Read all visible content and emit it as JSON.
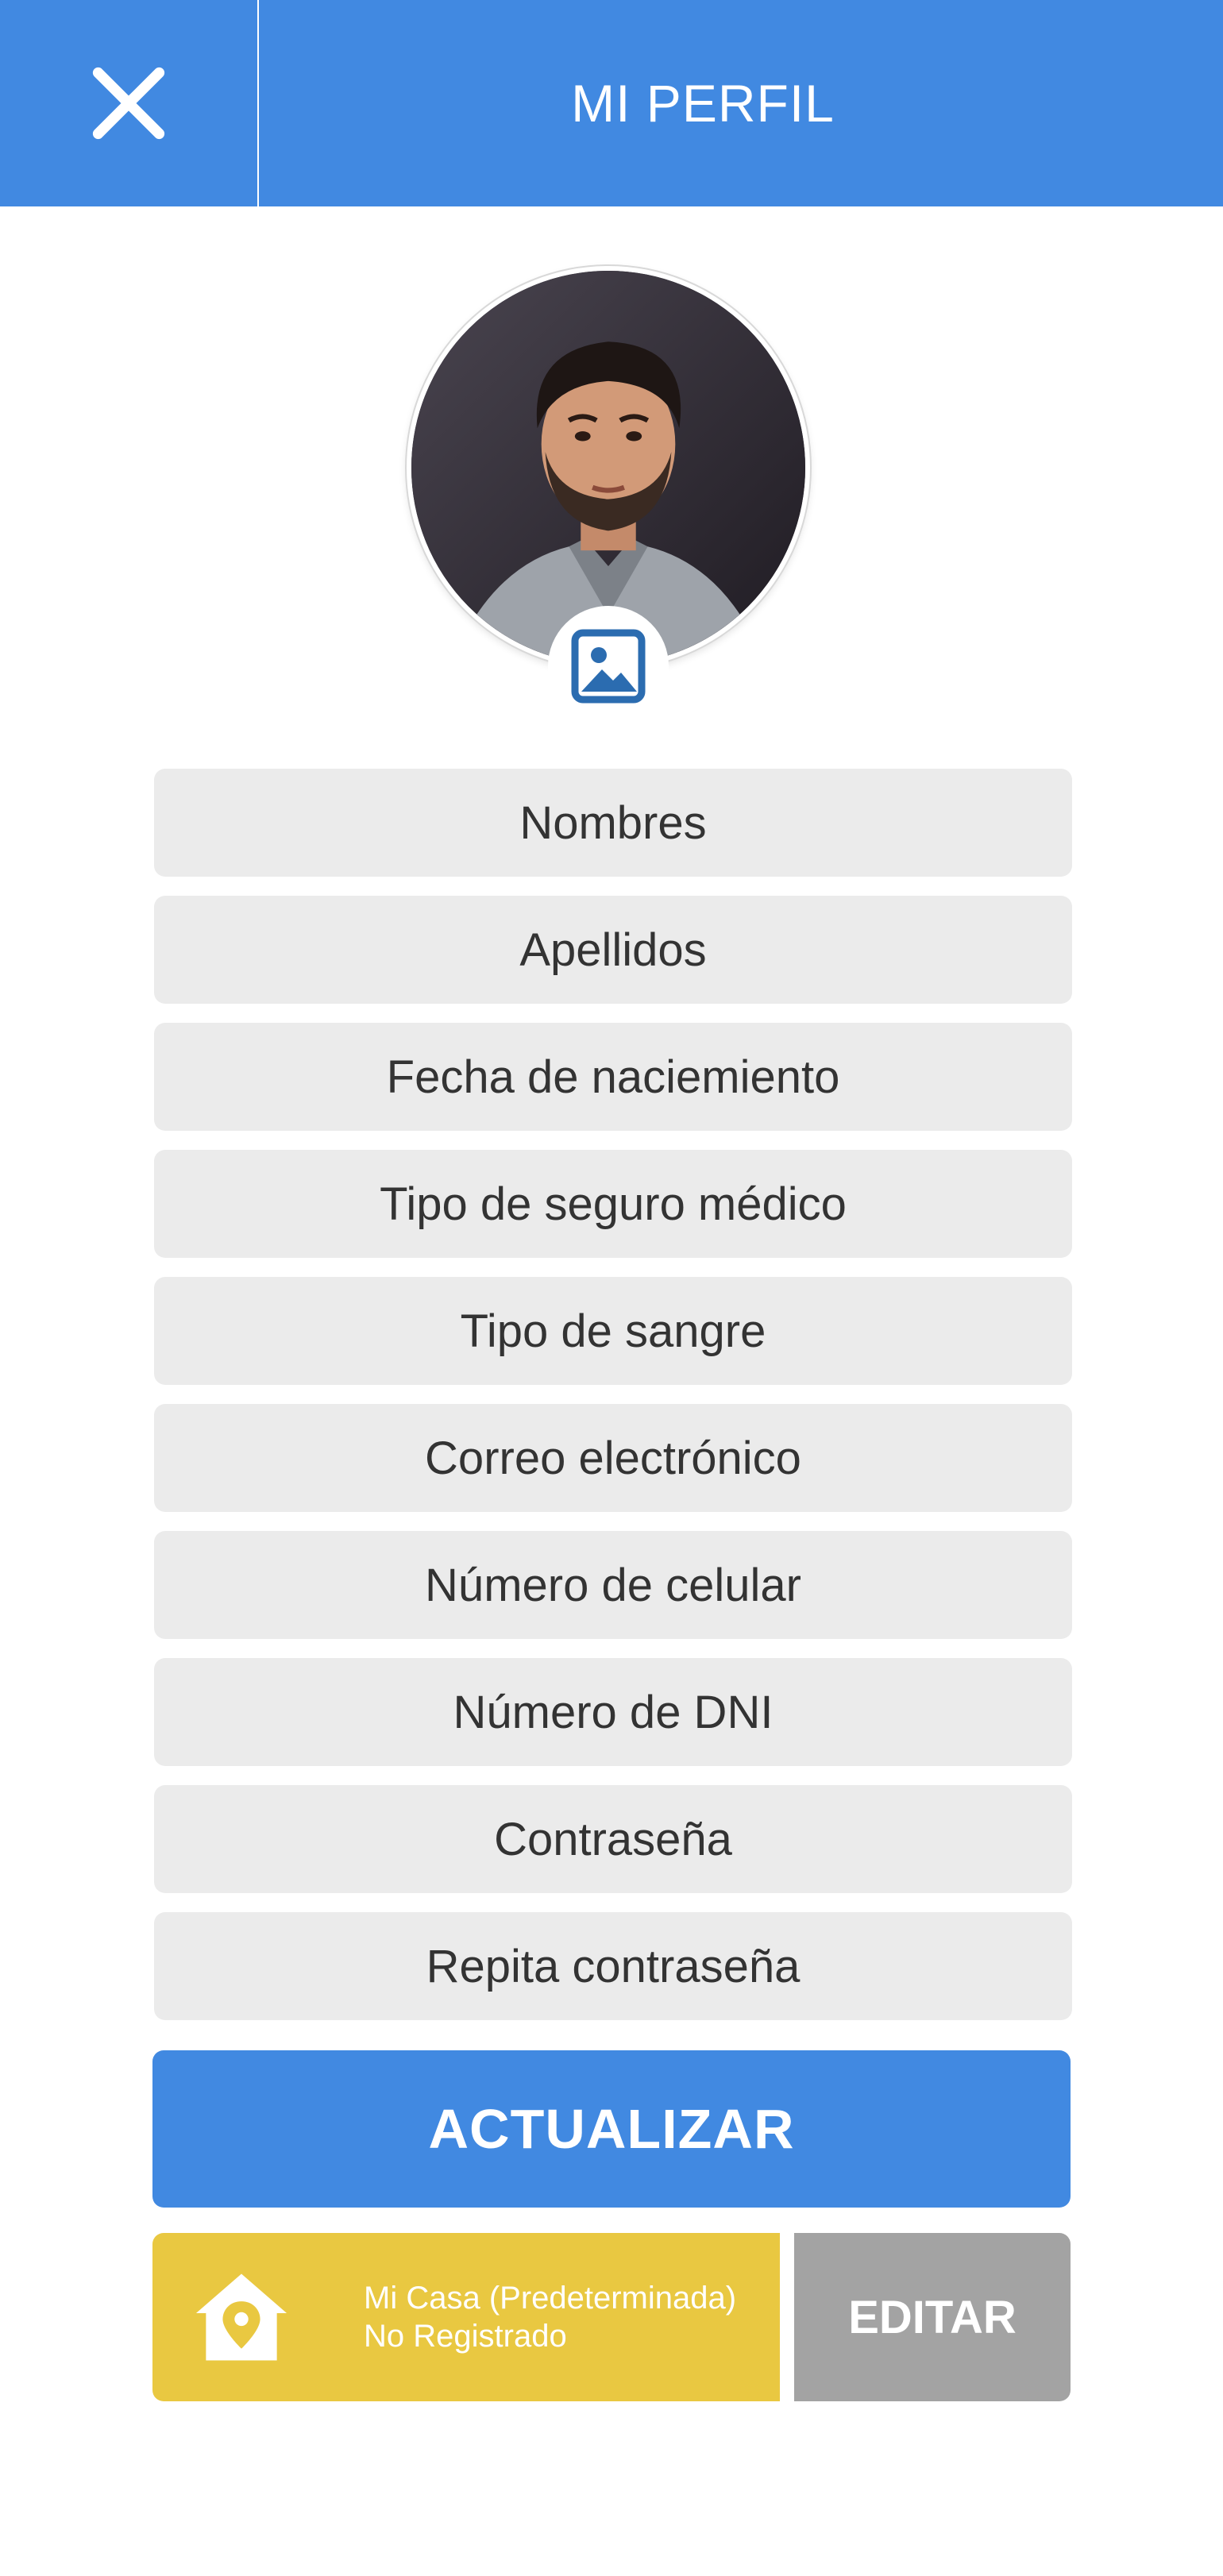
{
  "header": {
    "title": "MI PERFIL",
    "close_icon": "close-icon"
  },
  "profile": {
    "photo_icon": "image-icon"
  },
  "form": {
    "fields": [
      {
        "placeholder": "Nombres"
      },
      {
        "placeholder": "Apellidos"
      },
      {
        "placeholder": "Fecha de naciemiento"
      },
      {
        "placeholder": "Tipo de seguro médico"
      },
      {
        "placeholder": "Tipo de sangre"
      },
      {
        "placeholder": "Correo electrónico"
      },
      {
        "placeholder": "Número de celular"
      },
      {
        "placeholder": "Número de DNI"
      },
      {
        "placeholder": "Contraseña"
      },
      {
        "placeholder": "Repita contraseña"
      }
    ],
    "update_label": "ACTUALIZAR"
  },
  "address": {
    "icon": "home-location-icon",
    "name": "Mi Casa (Predeterminada)",
    "status": "No Registrado",
    "edit_label": "EDITAR"
  },
  "colors": {
    "primary": "#4189e1",
    "field_bg": "#ebebeb",
    "address_bg": "#e9c841",
    "edit_bg": "#a3a3a3",
    "icon_blue": "#2b6cb0"
  }
}
